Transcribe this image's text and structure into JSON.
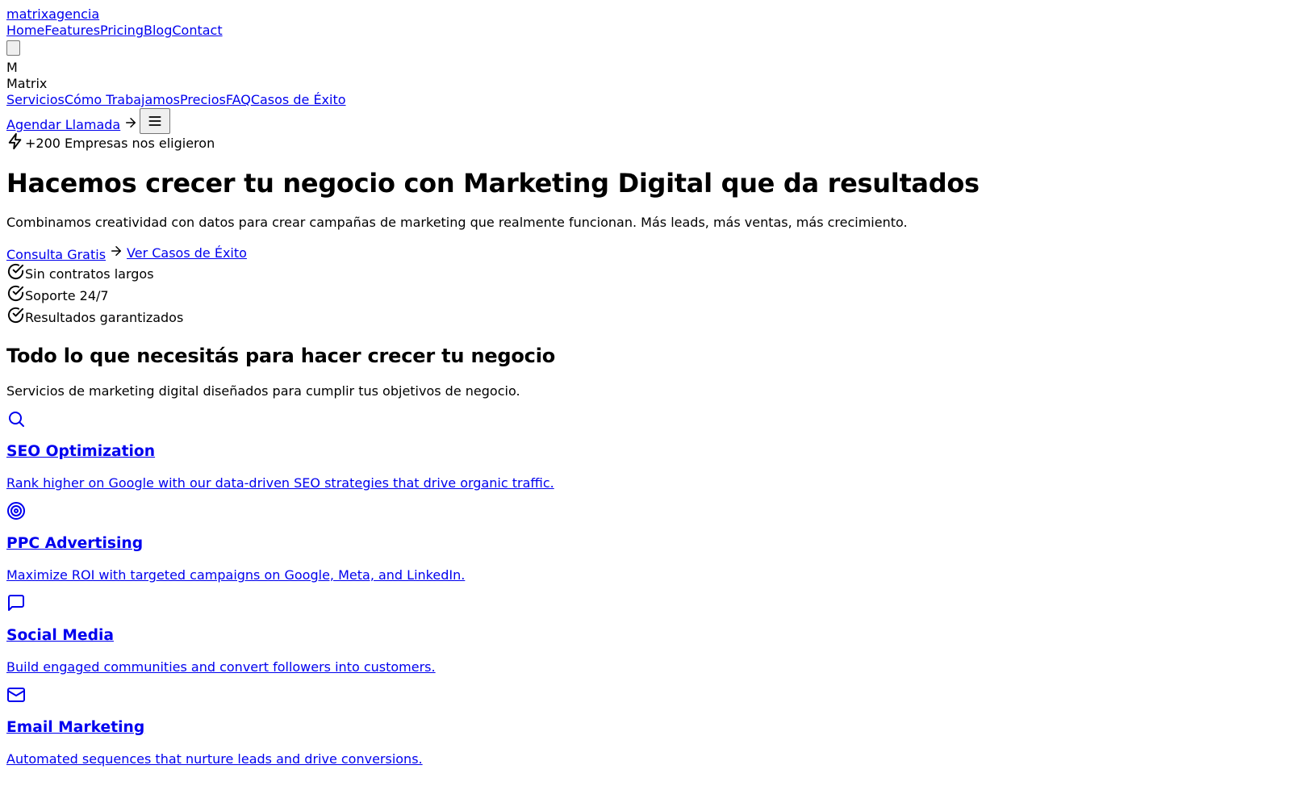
{
  "top_bar": {
    "brand_link": "matrixagencia",
    "nav": [
      "Home",
      "Features",
      "Pricing",
      "Blog",
      "Contact"
    ]
  },
  "logo": {
    "letter": "M",
    "name": "Matrix"
  },
  "main_nav": [
    "Servicios",
    "Cómo Trabajamos",
    "Precios",
    "FAQ",
    "Casos de Éxito"
  ],
  "header_cta": {
    "label": "Agendar Llamada"
  },
  "hero": {
    "badge": "+200 Empresas nos eligieron",
    "title": "Hacemos crecer tu negocio con Marketing Digital que da resultados",
    "subtitle": "Combinamos creatividad con datos para crear campañas de marketing que realmente funcionan. Más leads, más ventas, más crecimiento.",
    "primary_cta": "Consulta Gratis",
    "secondary_cta": "Ver Casos de Éxito",
    "benefits": [
      "Sin contratos largos",
      "Soporte 24/7",
      "Resultados garantizados"
    ]
  },
  "services": {
    "title": "Todo lo que necesitás para hacer crecer tu negocio",
    "subtitle": "Servicios de marketing digital diseñados para cumplir tus objetivos de negocio.",
    "items": [
      {
        "icon": "search-icon",
        "title": "SEO Optimization",
        "description": "Rank higher on Google with our data-driven SEO strategies that drive organic traffic."
      },
      {
        "icon": "target-icon",
        "title": "PPC Advertising",
        "description": "Maximize ROI with targeted campaigns on Google, Meta, and LinkedIn."
      },
      {
        "icon": "message-icon",
        "title": "Social Media",
        "description": "Build engaged communities and convert followers into customers."
      },
      {
        "icon": "mail-icon",
        "title": "Email Marketing",
        "description": "Automated sequences that nurture leads and drive conversions."
      }
    ]
  },
  "colors": {
    "link": "#0000ee",
    "text": "#000000",
    "background": "#ffffff"
  }
}
